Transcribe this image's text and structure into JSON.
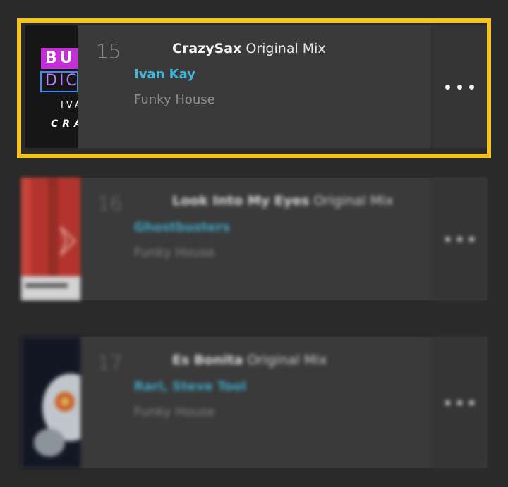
{
  "tracks": [
    {
      "number": "15",
      "title": "CrazySax",
      "mix": "Original Mix",
      "artist": "Ivan Kay",
      "genre": "Funky House",
      "art": {
        "line1": "BU",
        "line2": "DIC",
        "line3": "IVA",
        "line4": "CRA"
      },
      "highlighted": true
    },
    {
      "number": "16",
      "title": "Look Into My Eyes",
      "mix": "Original Mix",
      "artist": "Ghostbusters",
      "genre": "Funky House",
      "highlighted": false
    },
    {
      "number": "17",
      "title": "Es Bonita",
      "mix": "Original Mix",
      "artist": "Rari, Steve Tool",
      "genre": "Funky House",
      "highlighted": false
    }
  ],
  "colors": {
    "highlight": "#f5c41a",
    "artist": "#3fb6d8",
    "background": "#2a2a2a",
    "card": "#3a3a3a"
  },
  "icons": {
    "menu": "more-dots-icon"
  }
}
